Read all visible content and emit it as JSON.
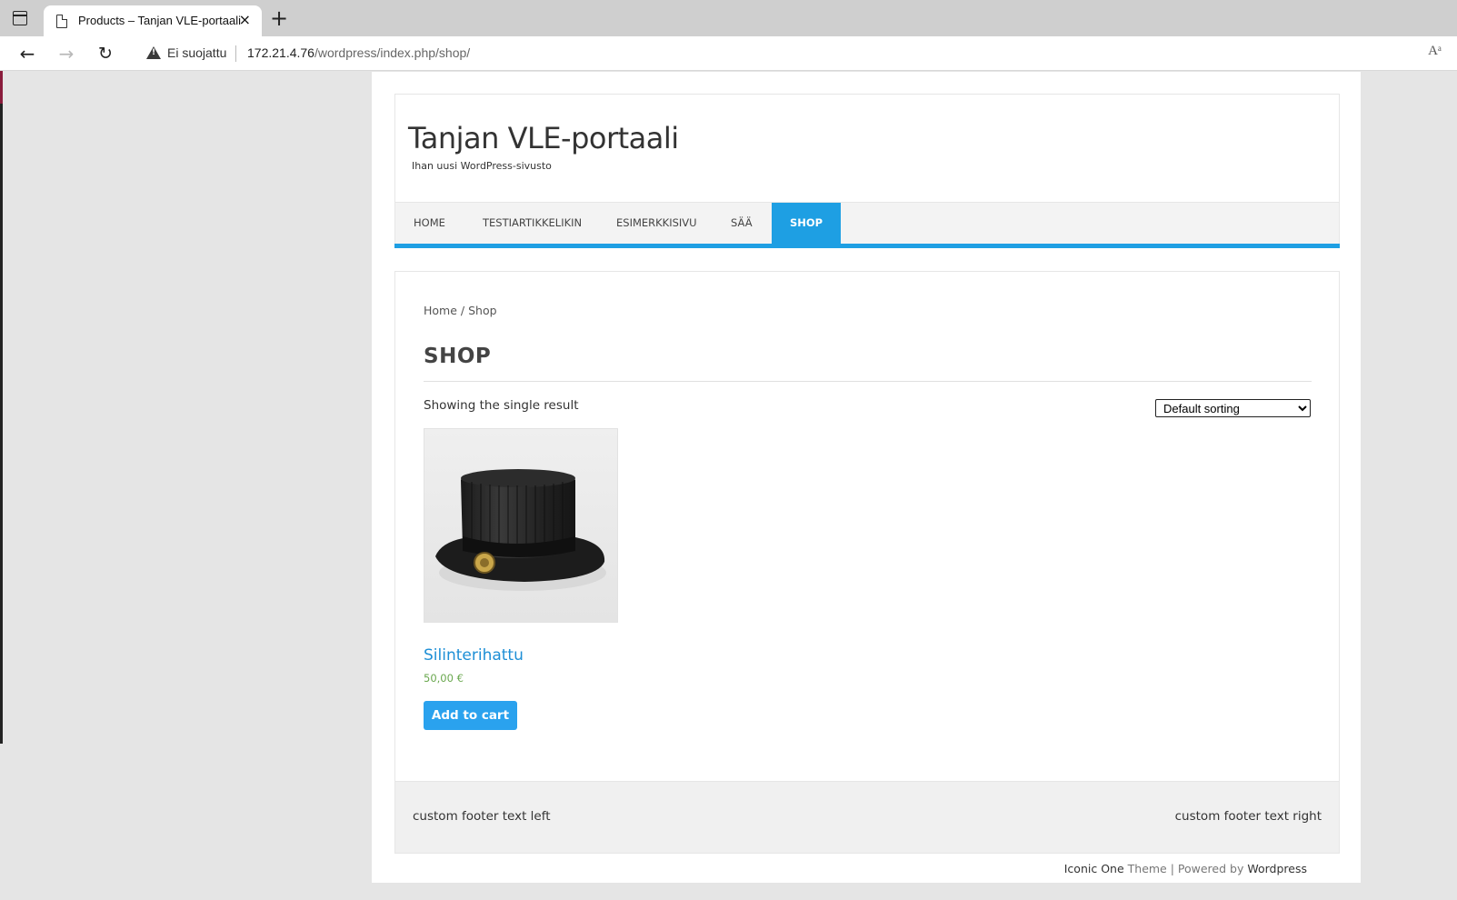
{
  "browser": {
    "tab_title": "Products – Tanjan VLE-portaali",
    "tab_close": "×",
    "new_tab": "+",
    "security_label": "Ei suojattu",
    "url_host": "172.21.4.76",
    "url_path": "/wordpress/index.php/shop/",
    "read_aloud": "Aᵃ"
  },
  "site": {
    "title": "Tanjan VLE-portaali",
    "tagline": "Ihan uusi WordPress-sivusto"
  },
  "nav": {
    "items": [
      {
        "label": "HOME"
      },
      {
        "label": "TESTIARTIKKELIKIN"
      },
      {
        "label": "ESIMERKKISIVU"
      },
      {
        "label": "SÄÄ"
      },
      {
        "label": "SHOP"
      }
    ],
    "active": "SHOP",
    "accent": "#1e9fe3"
  },
  "breadcrumb": {
    "home": "Home",
    "separator": " / ",
    "current": "Shop"
  },
  "shop": {
    "heading": "SHOP",
    "result_count": "Showing the single result",
    "sort_selected": "Default sorting",
    "product": {
      "name": "Silinterihattu",
      "price": "50,00 €",
      "add_to_cart": "Add to cart",
      "image": "top-hat-image"
    }
  },
  "footer": {
    "left": "custom footer text left",
    "right": "custom footer text right",
    "credit_theme_name": "Iconic One",
    "credit_theme_word": " Theme",
    "credit_sep": " | Powered by ",
    "credit_wordpress": "Wordpress"
  },
  "colors": {
    "link": "#1e8fd6",
    "price": "#6aa84f",
    "button": "#2aa2ee"
  }
}
